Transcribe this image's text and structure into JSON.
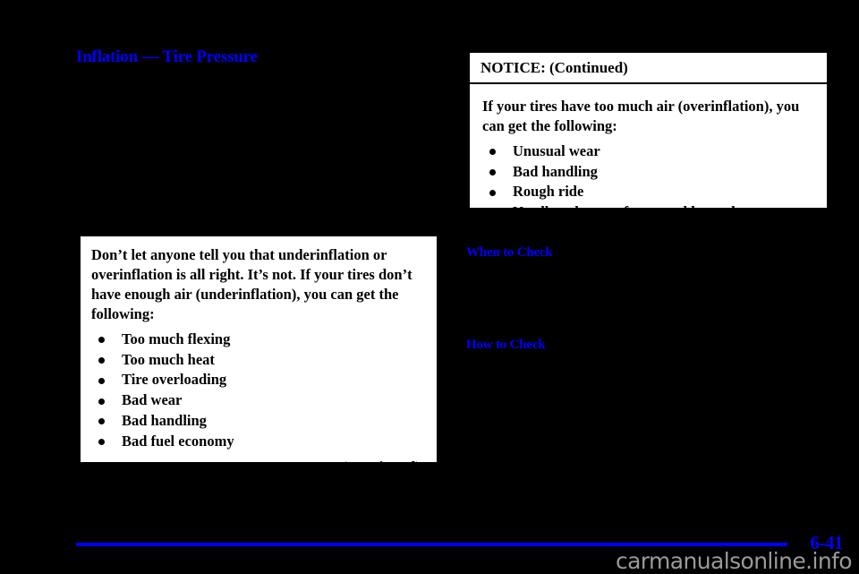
{
  "document": {
    "section_title": "Inflation — Tire Pressure",
    "page_number": "6-41",
    "watermark": "carmanualsonline.info"
  },
  "notice_left": {
    "paragraph": "Don’t let anyone tell you that underinflation or overinflation is all right. It’s not. If your tires don’t have enough air (underinflation), you can get the following:",
    "bullets": [
      "Too much flexing",
      "Too much heat",
      "Tire overloading",
      "Bad wear",
      "Bad handling",
      "Bad fuel economy"
    ],
    "continued_label": "NOTICE: (Continued)"
  },
  "notice_right": {
    "header": "NOTICE: (Continued)",
    "paragraph": "If your tires have too much air (overinflation), you can get the following:",
    "bullets": [
      "Unusual wear",
      "Bad handling",
      "Rough ride",
      "Needless damage from road hazards"
    ]
  },
  "subheadings": {
    "when_to_check": "When to Check",
    "how_to_check": "How to Check"
  },
  "colors": {
    "heading_blue": "#0000ff",
    "page_background": "#000000",
    "box_background": "#ffffff",
    "watermark_gray": "#9a9a9a"
  }
}
